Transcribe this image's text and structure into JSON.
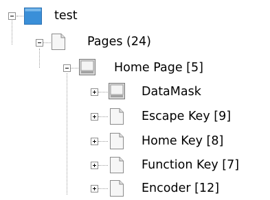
{
  "tree": {
    "root": {
      "label": "test",
      "icon": "blue-square-icon",
      "expanded": true
    },
    "pages": {
      "label": "Pages (24)",
      "icon": "page-icon",
      "expanded": true
    },
    "home_page": {
      "label": "Home Page [5]",
      "icon": "screen-page-icon",
      "expanded": true
    },
    "children": [
      {
        "label": "DataMask",
        "icon": "screen-page-icon",
        "expanded": false
      },
      {
        "label": "Escape Key [9]",
        "icon": "page-icon",
        "expanded": false
      },
      {
        "label": "Home Key [8]",
        "icon": "page-icon",
        "expanded": false
      },
      {
        "label": "Function Key [7]",
        "icon": "page-icon",
        "expanded": false
      },
      {
        "label": "Encoder [12]",
        "icon": "page-icon",
        "expanded": false
      }
    ]
  },
  "colors": {
    "blue_icon": "#3a8fd8",
    "tree_lines": "#9a9a9a"
  }
}
